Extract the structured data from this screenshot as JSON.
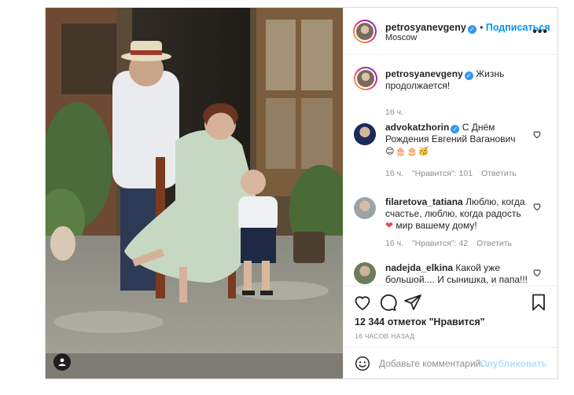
{
  "post": {
    "author": "petrosyanevgeny",
    "follow_label": "Подписаться",
    "location": "Moscow",
    "caption_text": "Жизнь продолжается!",
    "caption_time": "16 ч."
  },
  "comments": [
    {
      "username": "advokatzhorin",
      "verified": true,
      "text": "С Днём Рождения Евгений Ваганович",
      "emojis": "😊🎂🎂🥳",
      "time": "16 ч.",
      "likes": "\"Нравится\": 101",
      "reply": "Ответить"
    },
    {
      "username": "filaretova_tatiana",
      "verified": false,
      "text": "Люблю, когда счастье, люблю, когда радость",
      "text2": "мир вашему дому!",
      "time": "16 ч.",
      "likes": "\"Нравится\": 42",
      "reply": "Ответить"
    },
    {
      "username": "nadejda_elkina",
      "verified": false,
      "text": "Какой уже большой.... И сынишка, и папа!!! С днем Рожденья!!!",
      "time": "",
      "likes": "",
      "reply": ""
    }
  ],
  "stats": {
    "likes": "12 344 отметок \"Нравится\"",
    "posted": "16 ЧАСОВ НАЗАД"
  },
  "composer": {
    "placeholder": "Добавьте комментарий...",
    "publish_label": "Опубликовать"
  },
  "colors": {
    "accent": "#0095f6",
    "verified": "#3897f0",
    "muted": "#8e8e8e",
    "like_heart": "#ed4956"
  }
}
